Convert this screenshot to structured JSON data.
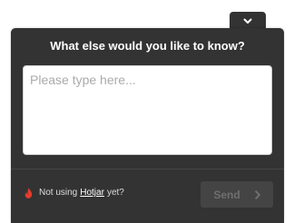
{
  "widget": {
    "question": "What else would you like to know?",
    "answer_placeholder": "Please type here...",
    "answer_value": "",
    "send_label": "Send",
    "footer": {
      "prefix": "Not using",
      "brand": "Hotjar",
      "suffix": "yet?"
    }
  },
  "icons": {
    "collapse": "chevron-down-icon",
    "brand": "flame-icon",
    "send": "chevron-right-icon"
  },
  "colors": {
    "panel": "#333333",
    "flame": "#e23d2d",
    "send_disabled_text": "#6f6f6f"
  }
}
